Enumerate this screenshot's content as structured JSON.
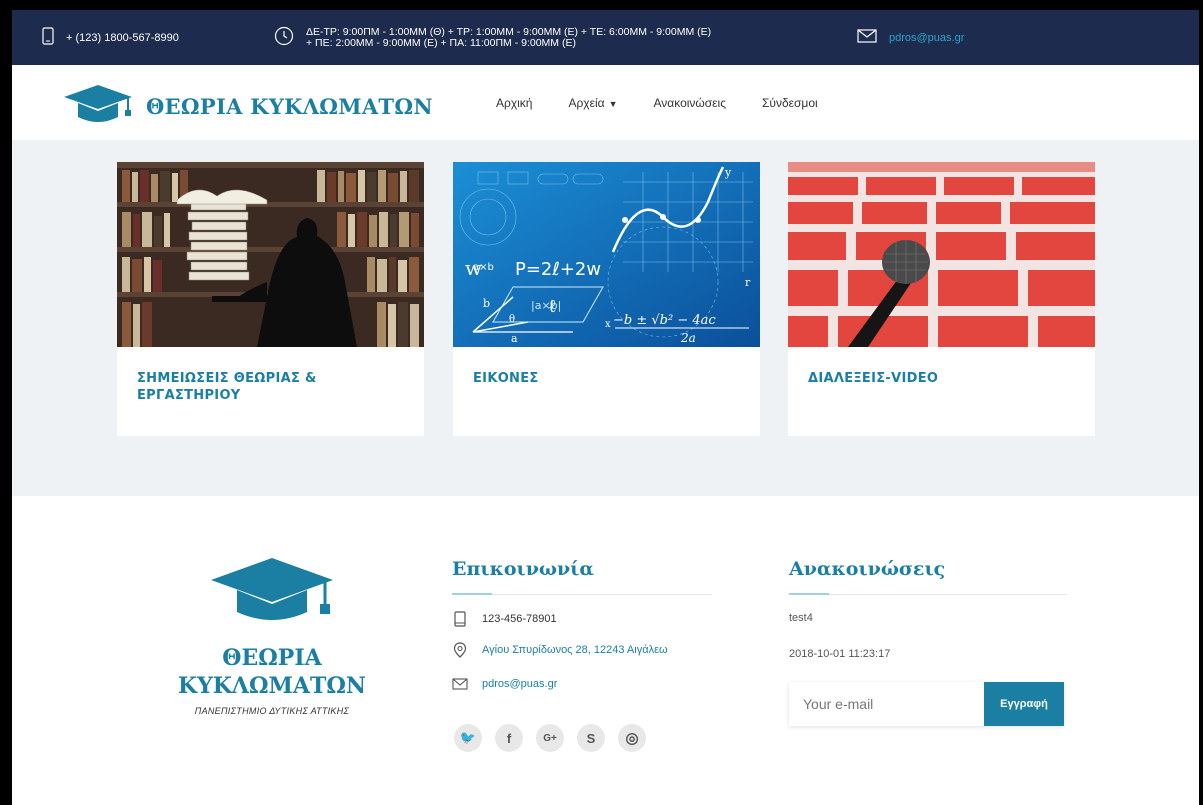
{
  "topbar": {
    "phone": "+ (123) 1800-567-8990",
    "hours_line1": "ΔΕ-ΤΡ: 9:00ΠΜ - 1:00ΜΜ (Θ) + ΤΡ: 1:00ΜΜ - 9:00ΜΜ (Ε) + ΤΕ: 6:00ΜΜ - 9:00ΜΜ (Ε)",
    "hours_line2": "+ ΠΕ: 2:00ΜΜ - 9:00ΜΜ (Ε) + ΠΑ: 11:00ΠΜ - 9:00ΜΜ (Ε)",
    "email": "pdros@puas.gr"
  },
  "nav": {
    "logo_text": "ΘΕΩΡΙΑ ΚΥΚΛΩΜΑΤΩΝ",
    "items": [
      {
        "label": "Αρχική"
      },
      {
        "label": "Αρχεία"
      },
      {
        "label": "Ανακοινώσεις"
      },
      {
        "label": "Σύνδεσμοι"
      }
    ]
  },
  "cards": [
    {
      "title_line1": "ΣΗΜΕΙΩΣΕΙΣ ΘΕΩΡΙΑΣ &",
      "title_line2": "ΕΡΓΑΣΤΗΡΙΟΥ"
    },
    {
      "title_line1": "ΕΙΚΟΝΕΣ",
      "title_line2": ""
    },
    {
      "title_line1": "ΔΙΑΛΕΞΕΙΣ-VIDEO",
      "title_line2": ""
    }
  ],
  "card_images": {
    "formula_main": "P=2ℓ+2w",
    "formula_quad": "−b ± √b² − 4ac",
    "formula_den": "2a",
    "formula_cross": "|a×b|",
    "var_w": "w",
    "var_l": "ℓ",
    "var_ab": "a×b",
    "var_b": "b",
    "var_a": "a",
    "var_theta": "θ",
    "var_x": "x",
    "var_y": "y",
    "var_r": "r"
  },
  "footer": {
    "logo_title_line1": "ΘΕΩΡΙΑ",
    "logo_title_line2": "ΚΥΚΛΩΜΑΤΩΝ",
    "logo_subtitle": "ΠΑΝΕΠΙΣΤΗΜΙΟ ΔΥΤΙΚΗΣ ΑΤΤΙΚΗΣ",
    "contact_title": "Επικοινωνία",
    "contact_phone": "123-456-78901",
    "contact_address": "Αγίου Σπυρίδωνος 28, 12243 Αιγάλεω",
    "contact_email": "pdros@puas.gr",
    "announcements_title": "Ανακοινώσεις",
    "announcement_text": "test4",
    "announcement_date": "2018-10-01 11:23:17",
    "email_placeholder": "Your e-mail",
    "subscribe_label": "Εγγραφή",
    "socials": [
      {
        "glyph": "🐦",
        "icon": "twitter-icon"
      },
      {
        "glyph": "f",
        "icon": "facebook-icon"
      },
      {
        "glyph": "G+",
        "icon": "google-plus-icon"
      },
      {
        "glyph": "S",
        "icon": "skype-icon"
      },
      {
        "glyph": "◎",
        "icon": "instagram-icon"
      }
    ]
  },
  "colors": {
    "topbar_bg": "#1d2b4f",
    "accent": "#1b7fa3",
    "main_bg": "#eef2f5"
  }
}
